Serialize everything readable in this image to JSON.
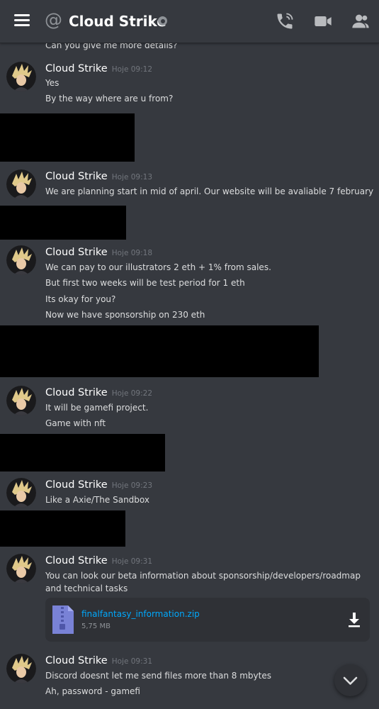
{
  "header": {
    "at_symbol": "@",
    "title": "Cloud Strike"
  },
  "messages": [
    {
      "lines": [
        "Can you give me more details?"
      ]
    },
    {
      "author": "Cloud Strike",
      "timestamp": "Hoje 09:12",
      "lines": [
        "Yes",
        "By the way where are u from?"
      ]
    },
    {
      "author": "Cloud Strike",
      "timestamp": "Hoje 09:13",
      "lines": [
        "We are planning start in mid of april. Our website will be avaliable 7 february"
      ]
    },
    {
      "author": "Cloud Strike",
      "timestamp": "Hoje 09:18",
      "lines": [
        "We can pay to our illustrators 2 eth + 1% from sales.",
        "But first two weeks will be test period for 1 eth",
        "Its okay for you?",
        "Now we have sponsorship on 230 eth"
      ]
    },
    {
      "author": "Cloud Strike",
      "timestamp": "Hoje 09:22",
      "lines": [
        "It will be gamefi project.",
        "Game with nft"
      ]
    },
    {
      "author": "Cloud Strike",
      "timestamp": "Hoje 09:23",
      "lines": [
        "Like a Axie/The Sandbox"
      ]
    },
    {
      "author": "Cloud Strike",
      "timestamp": "Hoje 09:31",
      "lines": [
        "You can look our beta information about sponsorship/developers/roadmap and technical tasks"
      ],
      "attachment": {
        "file_name": "finalfantasy_information.zip",
        "file_size": "5,75 MB"
      }
    },
    {
      "author": "Cloud Strike",
      "timestamp": "Hoje 09:31",
      "lines": [
        "Discord doesnt let me send files more than 8 mbytes",
        "Ah, password - gamefi"
      ]
    }
  ],
  "icons": {
    "menu": "hamburger-icon",
    "status": "status-icon",
    "call": "phone-call-icon",
    "video": "video-camera-icon",
    "members": "members-icon",
    "file": "zip-file-icon",
    "download": "download-icon",
    "scroll": "chevron-down-icon"
  },
  "colors": {
    "background": "#36393f",
    "text": "#dcddde",
    "link": "#00a8fc",
    "timestamp": "#72767d",
    "redaction": "#000000"
  }
}
